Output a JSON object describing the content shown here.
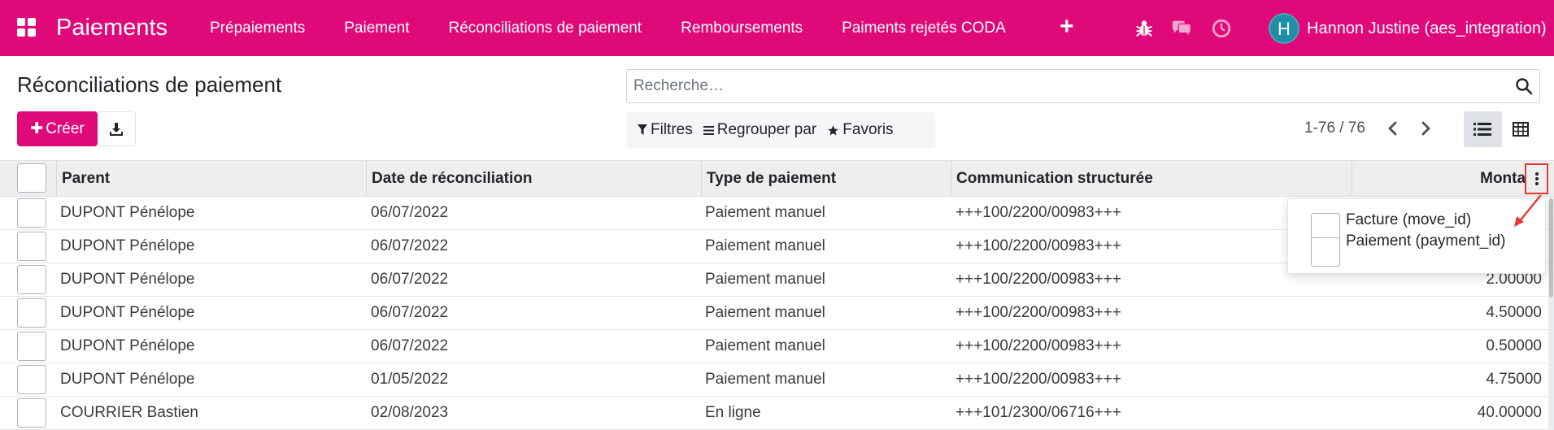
{
  "navbar": {
    "app_title": "Paiements",
    "menu": [
      "Prépaiements",
      "Paiement",
      "Réconciliations de paiement",
      "Remboursements",
      "Paiments rejetés CODA"
    ],
    "add_label": "+",
    "user_initial": "H",
    "user_name": "Hannon Justine (aes_integration)",
    "color": "#e0097a"
  },
  "control_panel": {
    "title": "Réconciliations de paiement",
    "create_label": "Créer",
    "search_placeholder": "Recherche…",
    "filters_label": "Filtres",
    "group_by_label": "Regrouper par",
    "favorites_label": "Favoris",
    "pager_value": "1-76 / 76"
  },
  "table": {
    "columns": {
      "parent": "Parent",
      "date": "Date de réconciliation",
      "type": "Type de paiement",
      "communication": "Communication structurée",
      "amount": "Montant"
    },
    "rows": [
      {
        "parent": "DUPONT Pénélope",
        "date": "06/07/2022",
        "type": "Paiement manuel",
        "communication": "+++100/2200/00983+++",
        "amount": ""
      },
      {
        "parent": "DUPONT Pénélope",
        "date": "06/07/2022",
        "type": "Paiement manuel",
        "communication": "+++100/2200/00983+++",
        "amount": ""
      },
      {
        "parent": "DUPONT Pénélope",
        "date": "06/07/2022",
        "type": "Paiement manuel",
        "communication": "+++100/2200/00983+++",
        "amount": "2.00000"
      },
      {
        "parent": "DUPONT Pénélope",
        "date": "06/07/2022",
        "type": "Paiement manuel",
        "communication": "+++100/2200/00983+++",
        "amount": "4.50000"
      },
      {
        "parent": "DUPONT Pénélope",
        "date": "06/07/2022",
        "type": "Paiement manuel",
        "communication": "+++100/2200/00983+++",
        "amount": "0.50000"
      },
      {
        "parent": "DUPONT Pénélope",
        "date": "01/05/2022",
        "type": "Paiement manuel",
        "communication": "+++100/2200/00983+++",
        "amount": "4.75000"
      },
      {
        "parent": "COURRIER Bastien",
        "date": "02/08/2023",
        "type": "En ligne",
        "communication": "+++101/2300/06716+++",
        "amount": "40.00000"
      }
    ]
  },
  "optional_columns": [
    {
      "label": "Facture (move_id)",
      "checked": false
    },
    {
      "label": "Paiement (payment_id)",
      "checked": false
    }
  ],
  "annotation_color": "#e53935"
}
